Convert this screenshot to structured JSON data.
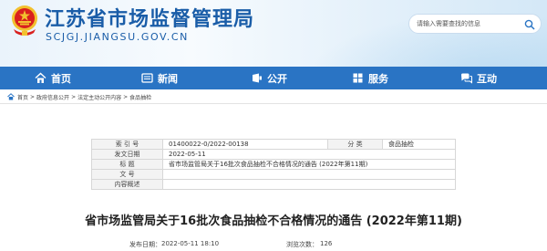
{
  "header": {
    "site_title": "江苏省市场监督管理局",
    "site_domain": "SCJGJ.JIANGSU.GOV.CN",
    "search_placeholder": "请输入需要查找的信息"
  },
  "nav": [
    {
      "label": "首页",
      "icon": "home-icon"
    },
    {
      "label": "新闻",
      "icon": "news-icon"
    },
    {
      "label": "公开",
      "icon": "public-info-icon"
    },
    {
      "label": "服务",
      "icon": "service-icon"
    },
    {
      "label": "互动",
      "icon": "interaction-icon"
    }
  ],
  "breadcrumb": {
    "items": [
      "首页",
      "政府信息公开",
      "法定主动公开内容",
      "食品抽检"
    ],
    "separator": ">"
  },
  "meta_table": {
    "index_label": "索 引 号",
    "index_value": "01400022-0/2022-00138",
    "category_label": "分 类",
    "category_value": "食品抽检",
    "date_label": "发文日期",
    "date_value": "2022-05-11",
    "title_label": "标 题",
    "title_value": "省市场监管局关于16批次食品抽检不合格情况的通告 (2022年第11期)",
    "doc_no_label": "文 号",
    "doc_no_value": "",
    "summary_label": "内容概述",
    "summary_value": ""
  },
  "article": {
    "title": "省市场监管局关于16批次食品抽检不合格情况的通告 (2022年第11期)",
    "publish_label": "发布日期：",
    "publish_value": "2022-05-11 18:10",
    "views_label": "浏览次数：",
    "views_value": "126"
  },
  "colors": {
    "brand_blue": "#1a5da8",
    "nav_blue": "#2a74c4",
    "emblem_red": "#d9201e",
    "emblem_gold": "#f2c12e"
  }
}
